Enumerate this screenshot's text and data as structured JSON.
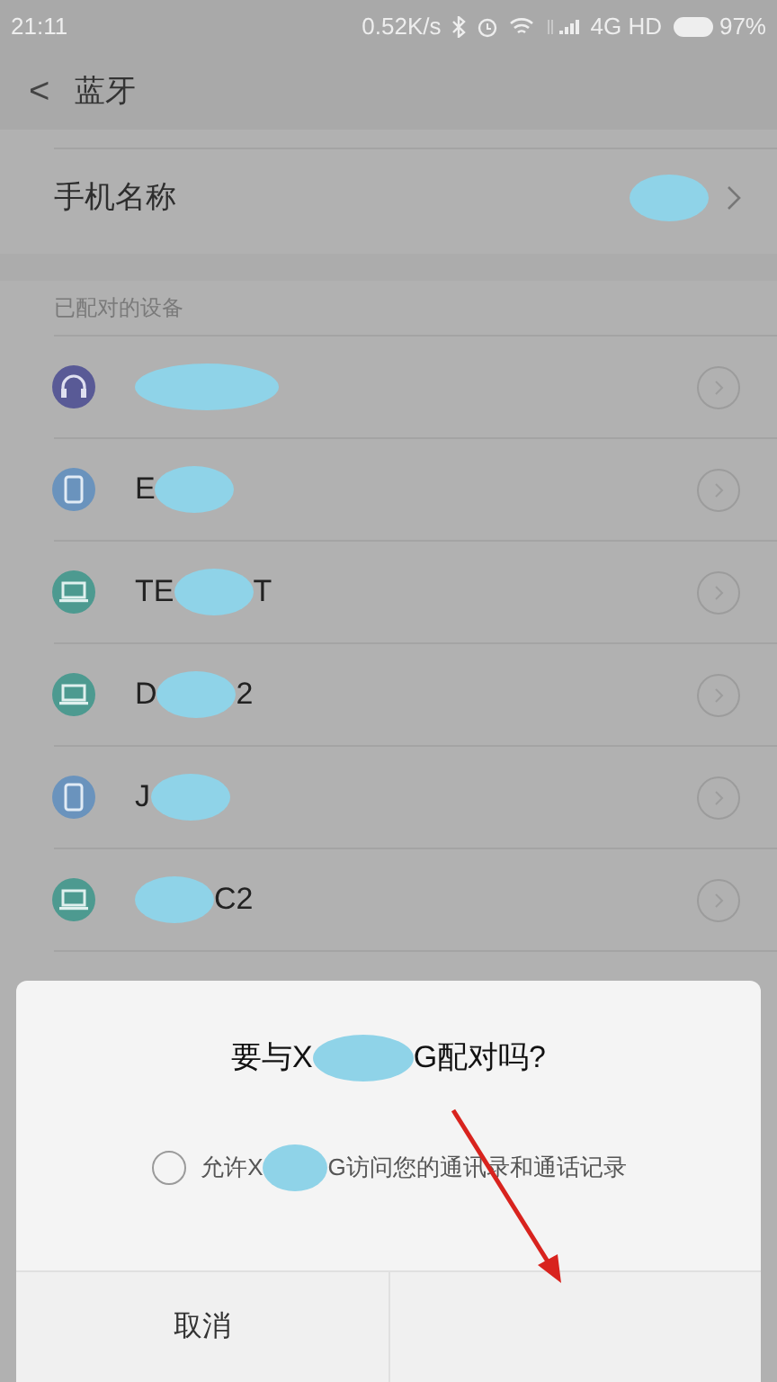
{
  "status_bar": {
    "time": "21:11",
    "speed": "0.52K/s",
    "network": "4G HD",
    "battery": "97%"
  },
  "header": {
    "back": "<",
    "title": "蓝牙"
  },
  "phone_name": {
    "label": "手机名称"
  },
  "section": "已配对的设备",
  "devices": [
    {
      "kind": "headset"
    },
    {
      "kind": "phone",
      "name_start": "E"
    },
    {
      "kind": "laptop",
      "name_start": "TE",
      "name_end": "T"
    },
    {
      "kind": "laptop",
      "name_start": "D",
      "name_end": "2"
    },
    {
      "kind": "phone",
      "name_start": "J"
    },
    {
      "kind": "laptop",
      "name_end": "C2"
    }
  ],
  "dialog": {
    "title_start": "要与X",
    "title_end": "G配对吗?",
    "allow": {
      "checked": false,
      "text_start": "允许X",
      "text_end": "G访问您的通讯录和通话记录"
    },
    "cancel": "取消"
  }
}
